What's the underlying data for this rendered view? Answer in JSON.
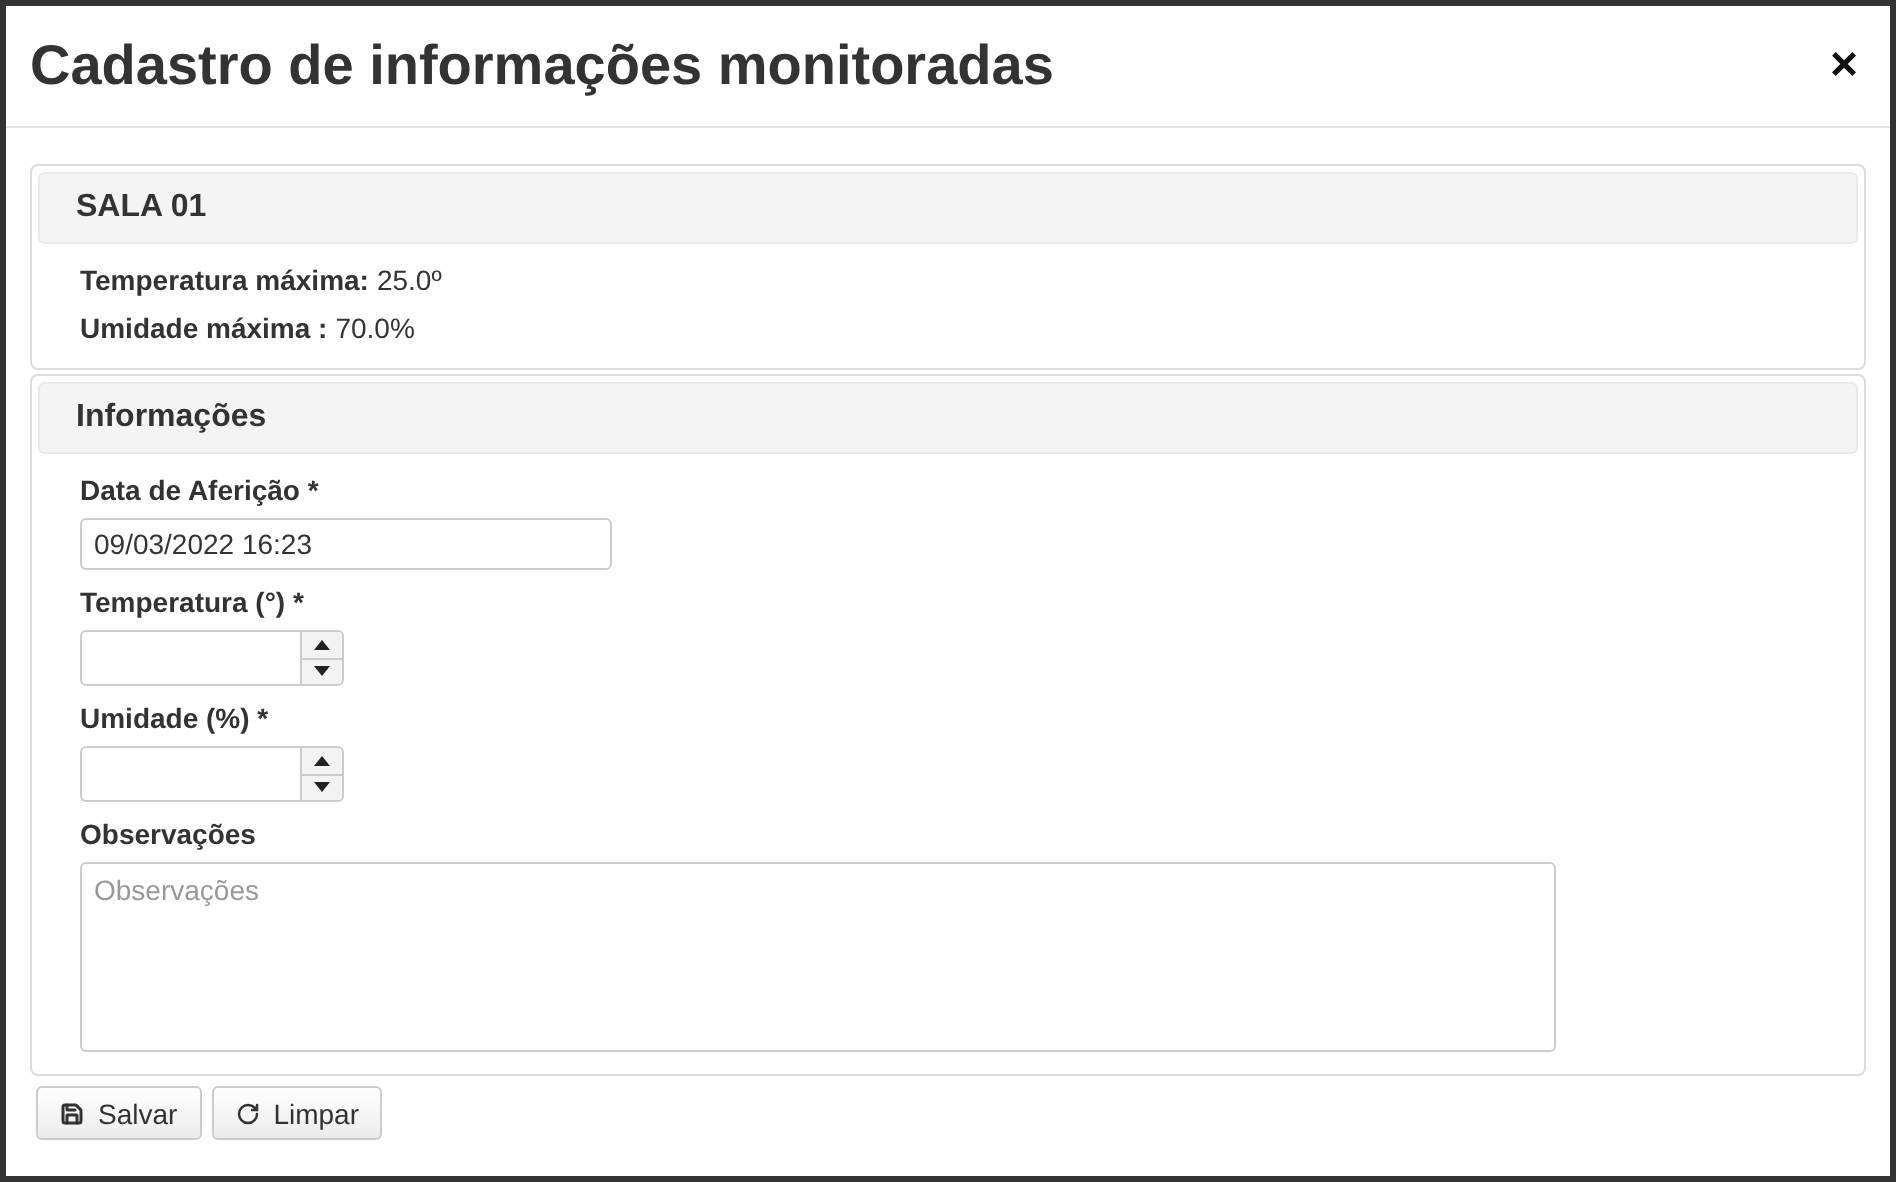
{
  "dialog": {
    "title": "Cadastro de informações monitoradas",
    "close": "×"
  },
  "room_panel": {
    "title": "SALA 01",
    "limits": [
      {
        "label": "Temperatura máxima:",
        "value": "25.0º"
      },
      {
        "label": "Umidade máxima :",
        "value": "70.0%"
      }
    ]
  },
  "form_panel": {
    "title": "Informações",
    "fields": [
      {
        "kind": "text",
        "label": "Data de Aferição *",
        "value": "09/03/2022 16:23"
      },
      {
        "kind": "number",
        "label": "Temperatura (°) *"
      },
      {
        "kind": "number",
        "label": "Umidade (%) *"
      },
      {
        "kind": "textarea",
        "label": "Observações",
        "placeholder": "Observações"
      }
    ]
  },
  "buttons": [
    {
      "kind": "save",
      "label": "Salvar"
    },
    {
      "kind": "reset",
      "label": "Limpar"
    }
  ]
}
